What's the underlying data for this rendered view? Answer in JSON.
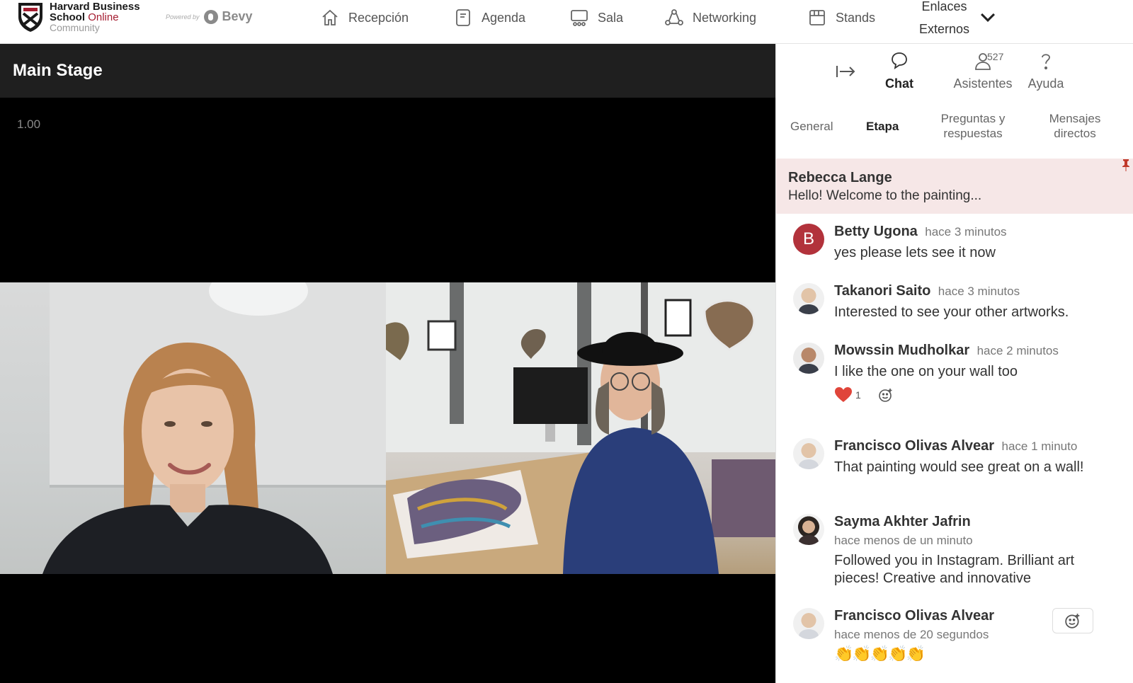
{
  "brand": {
    "line1": "Harvard Business",
    "line2a": "School",
    "line2b": "Online",
    "line3": "Community",
    "powered_label": "Powered by",
    "platform": "Bevy"
  },
  "nav": {
    "items": [
      {
        "label": "Recepción",
        "icon": "home-icon"
      },
      {
        "label": "Agenda",
        "icon": "agenda-icon"
      },
      {
        "label": "Sala",
        "icon": "theater-icon"
      },
      {
        "label": "Networking",
        "icon": "network-icon"
      },
      {
        "label": "Stands",
        "icon": "booth-icon"
      }
    ],
    "dropdown_line1": "Enlaces",
    "dropdown_line2": "Externos"
  },
  "stage": {
    "title": "Main Stage",
    "zoom_readout": "1.00"
  },
  "panel": {
    "tabs": [
      {
        "label": "Chat",
        "active": true
      },
      {
        "label": "Asistentes",
        "badge": "527"
      },
      {
        "label": "Ayuda"
      }
    ],
    "subtabs": [
      "General",
      "Etapa",
      "Preguntas y respuestas",
      "Mensajes directos"
    ],
    "active_subtab": "Etapa",
    "pinned": {
      "name": "Rebecca Lange",
      "text": "Hello! Welcome to the painting..."
    },
    "messages": [
      {
        "name": "Betty Ugona",
        "time": "hace 3 minutos",
        "text": "yes please lets see it now",
        "avatar_letter": "B"
      },
      {
        "name": "Takanori Saito",
        "time": "hace 3 minutos",
        "text": "Interested to see your other artworks."
      },
      {
        "name": "Mowssin Mudholkar",
        "time": "hace 2 minutos",
        "text": "I like the one on your wall too",
        "reaction_count": "1"
      },
      {
        "name": "Francisco Olivas Alvear",
        "time": "hace 1 minuto",
        "text": "That painting would see great on a wall!"
      },
      {
        "name": "Sayma Akhter Jafrin",
        "time": "hace menos de un minuto",
        "text": "Followed you in Instagram. Brilliant art pieces! Creative and innovative"
      },
      {
        "name": "Francisco Olivas Alvear",
        "time": "hace menos de 20 segundos",
        "text": "👏👏👏👏👏"
      }
    ]
  },
  "colors": {
    "accent": "#a51c30",
    "pinned_bg": "#f6e7e7",
    "stage_header": "#1f1f1f"
  }
}
